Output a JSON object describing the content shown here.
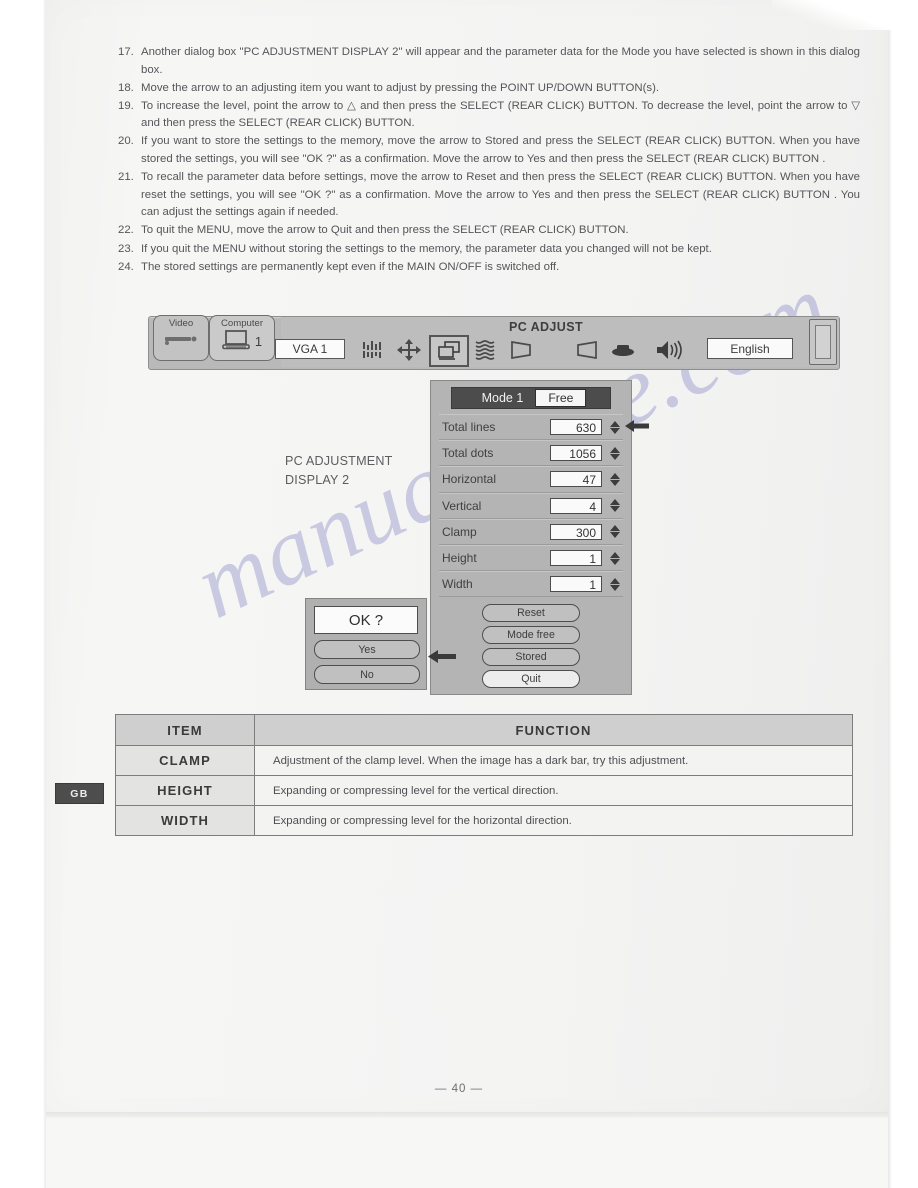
{
  "document": {
    "page_number": "— 40 —",
    "language_tab": "GB",
    "watermark": "manualshive.com"
  },
  "steps": [
    {
      "num": "17.",
      "text": "Another dialog box \"PC ADJUSTMENT DISPLAY 2\" will appear and the parameter data for the Mode you have selected is shown in this dialog box."
    },
    {
      "num": "18.",
      "text": "Move the arrow to an adjusting item you want to adjust by pressing the POINT UP/DOWN BUTTON(s)."
    },
    {
      "num": "19.",
      "text": "To increase the level, point the arrow to △ and then press the SELECT (REAR CLICK) BUTTON. To decrease the level, point the arrow to ▽ and then press the SELECT (REAR CLICK) BUTTON."
    },
    {
      "num": "20.",
      "text": "If you want to store the settings to the memory, move the arrow to Stored and press the SELECT (REAR CLICK) BUTTON. When you have stored the settings, you will see \"OK ?\" as a confirmation.  Move the arrow to Yes and then press the SELECT (REAR CLICK) BUTTON ."
    },
    {
      "num": "21.",
      "text": "To recall the parameter data before settings, move the arrow to Reset and then press the SELECT (REAR CLICK) BUTTON. When you have reset the settings, you will see \"OK ?\" as a confirmation. Move the arrow to Yes and then press the SELECT (REAR CLICK) BUTTON . You can adjust the settings again if needed."
    },
    {
      "num": "22.",
      "text": "To quit the MENU, move the arrow to Quit and then press the SELECT (REAR CLICK) BUTTON."
    },
    {
      "num": "23.",
      "text": "If you quit the MENU without storing the settings to the memory, the parameter data you changed will not be kept."
    },
    {
      "num": "24.",
      "text": "The stored settings are permanently kept even if the MAIN ON/OFF is switched off."
    }
  ],
  "osd": {
    "tabs": [
      {
        "label": "Video",
        "icon": "video-source-icon",
        "selected": false
      },
      {
        "label": "Computer",
        "icon": "computer-laptop-icon",
        "badge": "1",
        "selected": true
      }
    ],
    "menu_title": "PC ADJUST",
    "source_value": "VGA 1",
    "icons": [
      {
        "name": "fine-sync-icon",
        "selected": false
      },
      {
        "name": "position-arrows-icon",
        "selected": false
      },
      {
        "name": "pc-adjust-icon",
        "selected": true
      },
      {
        "name": "noise-wave-icon",
        "selected": false
      },
      {
        "name": "keystone-icon",
        "selected": false
      },
      {
        "name": "keystone-2-icon",
        "selected": false
      },
      {
        "name": "no-show-icon",
        "selected": false
      },
      {
        "name": "volume-speaker-icon",
        "selected": false
      }
    ],
    "language_value": "English"
  },
  "caption": {
    "line1": "PC ADJUSTMENT",
    "line2": "DISPLAY 2"
  },
  "panel": {
    "mode_label": "Mode 1",
    "mode_free_label": "Free",
    "parameters": [
      {
        "name": "Total lines",
        "value": "630",
        "pointer": true
      },
      {
        "name": "Total dots",
        "value": "1056",
        "pointer": false
      },
      {
        "name": "Horizontal",
        "value": "47",
        "pointer": false
      },
      {
        "name": "Vertical",
        "value": "4",
        "pointer": false
      },
      {
        "name": "Clamp",
        "value": "300",
        "pointer": false
      },
      {
        "name": "Height",
        "value": "1",
        "pointer": false
      },
      {
        "name": "Width",
        "value": "1",
        "pointer": false
      }
    ],
    "buttons": [
      {
        "label": "Reset",
        "highlighted": false
      },
      {
        "label": "Mode free",
        "highlighted": false
      },
      {
        "label": "Stored",
        "highlighted": false
      },
      {
        "label": "Quit",
        "highlighted": true
      }
    ]
  },
  "confirm_dialog": {
    "title": "OK ?",
    "yes_label": "Yes",
    "no_label": "No"
  },
  "table": {
    "headers": [
      "ITEM",
      "FUNCTION"
    ],
    "rows": [
      {
        "item": "CLAMP",
        "function": "Adjustment of the clamp level. When the image has a dark bar, try this adjustment."
      },
      {
        "item": "HEIGHT",
        "function": "Expanding or compressing level for the vertical direction."
      },
      {
        "item": "WIDTH",
        "function": "Expanding or compressing level for the horizontal direction."
      }
    ]
  },
  "colors": {
    "osd_gray": "#b9b9b9",
    "panel_gray": "#b4b4b4",
    "mode_bar": "#4c4c4c",
    "tab_dark": "#4d4d4d",
    "watermark": "#8d8ec9"
  }
}
